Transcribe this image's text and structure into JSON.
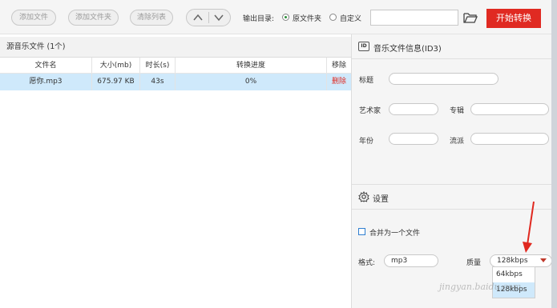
{
  "toolbar": {
    "add_file": "添加文件",
    "add_folder": "添加文件夹",
    "clear_list": "清除列表",
    "output_label": "输出目录:",
    "opt_original": "原文件夹",
    "opt_custom": "自定义",
    "path_value": "",
    "start": "开始转换"
  },
  "file_list": {
    "title": "源音乐文件 (1个)",
    "columns": [
      "文件名",
      "大小(mb)",
      "时长(s)",
      "转换进度",
      "移除"
    ],
    "rows": [
      {
        "name": "愿你.mp3",
        "size": "675.97 KB",
        "duration": "43s",
        "progress": "0%",
        "remove": "删除"
      }
    ]
  },
  "id3": {
    "title": "音乐文件信息(ID3)",
    "badge": "ID",
    "title_label": "标题",
    "artist_label": "艺术家",
    "album_label": "专辑",
    "year_label": "年份",
    "genre_label": "流派"
  },
  "settings": {
    "title": "设置",
    "merge_label": "合并为一个文件",
    "format_label": "格式:",
    "format_value": "mp3",
    "quality_label": "质量",
    "quality_value": "128kbps",
    "quality_options": [
      "64kbps",
      "128kbps"
    ]
  },
  "watermark": "jingyan.baidu.com",
  "colors": {
    "accent": "#e02a22",
    "selected_row": "#cfe9fb",
    "annotation": "#e0281f"
  }
}
